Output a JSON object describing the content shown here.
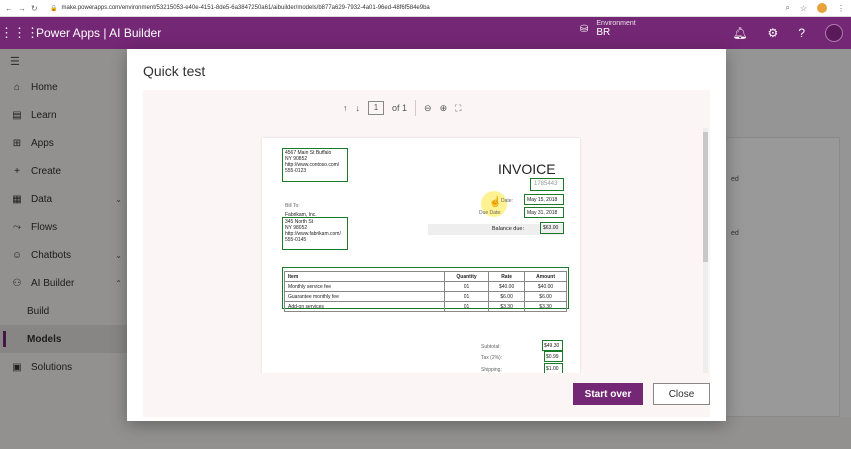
{
  "browser": {
    "url": "make.powerapps.com/environment/53215053-e40e-4151-8de5-6a3847250a61/aibuilder/models/b877a629-7932-4a01-96ed-48f6f584e9ba"
  },
  "header": {
    "app_title": "Power Apps | AI Builder",
    "env_label": "Environment",
    "env_value": "BR",
    "help": "?"
  },
  "sidebar": {
    "items": [
      {
        "label": "Home"
      },
      {
        "label": "Learn"
      },
      {
        "label": "Apps"
      },
      {
        "label": "Create"
      },
      {
        "label": "Data"
      },
      {
        "label": "Flows"
      },
      {
        "label": "Chatbots"
      },
      {
        "label": "AI Builder"
      },
      {
        "label": "Build"
      },
      {
        "label": "Models"
      },
      {
        "label": "Solutions"
      }
    ]
  },
  "background": {
    "text1": "ed",
    "text2": "ed"
  },
  "dialog": {
    "title": "Quick test",
    "toolbar": {
      "page": "1",
      "of": "of 1"
    },
    "buttons": {
      "start_over": "Start over",
      "close": "Close"
    }
  },
  "invoice": {
    "title": "INVOICE",
    "number": "1785443",
    "from": [
      "4567 Main St Buffalo",
      "NY 90852",
      "http://www.contoso.com/",
      "555-0123"
    ],
    "bill_to_label": "Bill To:",
    "bill_to_name": "Fabrikam, Inc.",
    "bill_to": [
      "345 North St",
      "NY 98052",
      "http://www.fabrikam.com/",
      "555-0145"
    ],
    "date_label": "Date:",
    "date": "May 15, 2018",
    "due_label": "Due Date:",
    "due_date": "May 31, 2018",
    "balance_label": "Balance due:",
    "balance": "$63.00",
    "columns": [
      "Item",
      "Quantity",
      "Rate",
      "Amount"
    ],
    "rows": [
      [
        "Monthly service fee",
        "01",
        "$40.00",
        "$40.00"
      ],
      [
        "Guarantee monthly fee",
        "01",
        "$6.00",
        "$6.00"
      ],
      [
        "Add-on services",
        "01",
        "$3.30",
        "$3.30"
      ]
    ],
    "subtotal_label": "Subtotal:",
    "subtotal": "$49.30",
    "tax_label": "Tax (2%):",
    "tax": "$0.99",
    "shipping_label": "Shipping:",
    "shipping": "$1.00"
  }
}
